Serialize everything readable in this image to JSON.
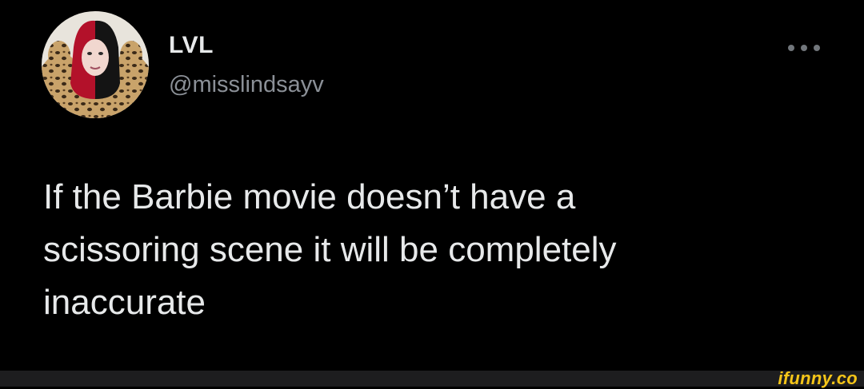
{
  "tweet": {
    "display_name": "LVL",
    "handle": "@misslindsayv",
    "text": "If the Barbie movie doesn’t have a\nscissoring scene it will be completely\ninaccurate",
    "avatar_icon": "user-avatar-photo",
    "more_icon": "more-options-icon"
  },
  "footer": {
    "brand": "ifunny.co"
  },
  "colors": {
    "background": "#000000",
    "primary_text": "#e7e9ea",
    "secondary_text": "#8b9097",
    "footer_bar": "#1d1d1f",
    "brand": "#f5c518"
  }
}
